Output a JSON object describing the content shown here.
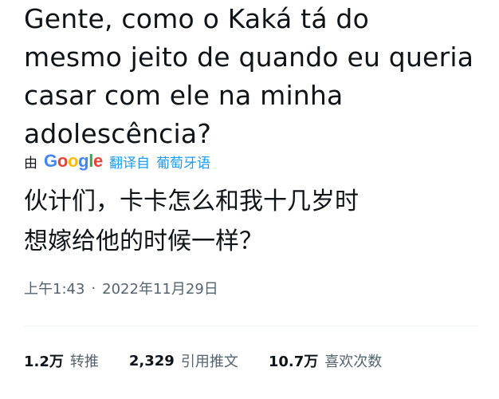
{
  "tweet": {
    "original_text": "Gente, como o Kaká tá do\nmesmo jeito de quando eu queria\ncasar com ele na minha\nadolescência?",
    "translation": {
      "by_label": "由",
      "provider": "Google",
      "translated_from_label": "翻译自",
      "source_language": "葡萄牙语"
    },
    "translated_text": "伙计们，卡卡怎么和我十几岁时\n想嫁给他的时候一样？",
    "time": "上午1:43",
    "separator": "·",
    "date": "2022年11月29日",
    "stats": [
      {
        "value": "1.2万",
        "label": "转推"
      },
      {
        "value": "2,329",
        "label": "引用推文"
      },
      {
        "value": "10.7万",
        "label": "喜欢次数"
      }
    ]
  },
  "colors": {
    "text_primary": "#0f1419",
    "text_secondary": "#536471",
    "link_blue": "#1d9bf0",
    "divider": "#eff3f4"
  }
}
